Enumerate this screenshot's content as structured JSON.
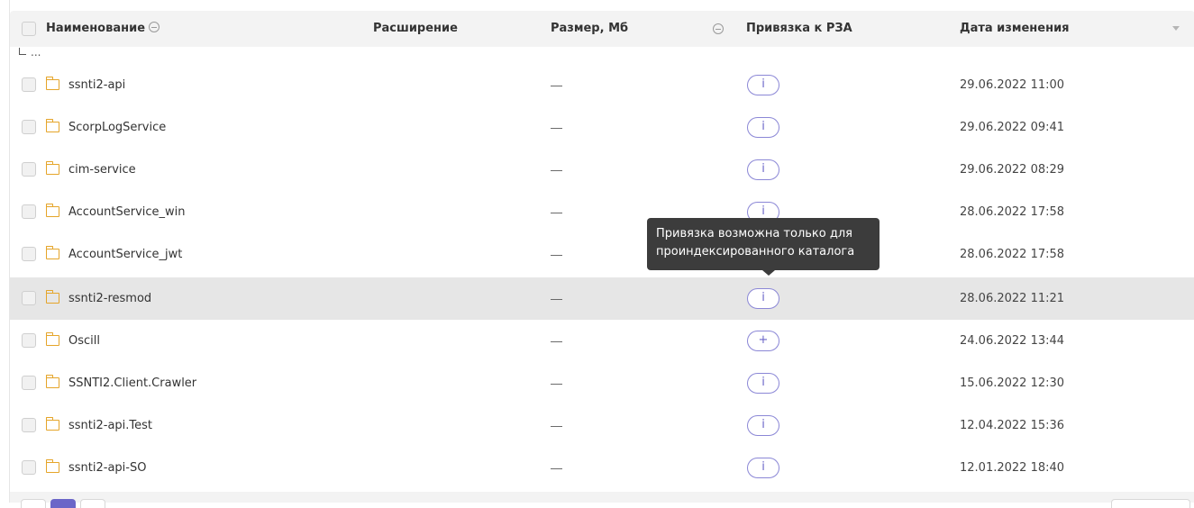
{
  "table": {
    "columns": {
      "name": "Наименование",
      "extension": "Расширение",
      "size": "Размер, Мб",
      "link": "Привязка к РЗА",
      "date": "Дата изменения"
    },
    "up_label": "...",
    "rows": [
      {
        "name": "ssnti2-api",
        "size": "—",
        "link": "i",
        "date": "29.06.2022 11:00"
      },
      {
        "name": "ScorpLogService",
        "size": "—",
        "link": "i",
        "date": "29.06.2022 09:41"
      },
      {
        "name": "cim-service",
        "size": "—",
        "link": "i",
        "date": "29.06.2022 08:29"
      },
      {
        "name": "AccountService_win",
        "size": "—",
        "link": "i",
        "date": "28.06.2022 17:58"
      },
      {
        "name": "AccountService_jwt",
        "size": "—",
        "link": "i",
        "date": "28.06.2022 17:58"
      },
      {
        "name": "ssnti2-resmod",
        "size": "—",
        "link": "i",
        "date": "28.06.2022 11:21"
      },
      {
        "name": "Oscill",
        "size": "—",
        "link": "+",
        "date": "24.06.2022 13:44"
      },
      {
        "name": "SSNTI2.Client.Crawler",
        "size": "—",
        "link": "i",
        "date": "15.06.2022 12:30"
      },
      {
        "name": "ssnti2-api.Test",
        "size": "—",
        "link": "i",
        "date": "12.04.2022 15:36"
      },
      {
        "name": "ssnti2-api-SO",
        "size": "—",
        "link": "i",
        "date": "12.01.2022 18:40"
      }
    ]
  },
  "tooltip": {
    "text": "Привязка возможна только для\nпроиндексированного каталога"
  },
  "colors": {
    "accent": "#6b66c8",
    "folder": "#e5a52a",
    "highlight_row": "#e6e6e6",
    "tooltip_bg": "#3c3c3c"
  }
}
